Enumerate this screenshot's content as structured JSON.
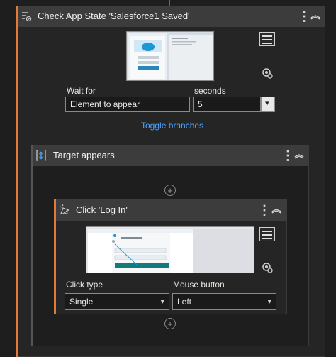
{
  "outer": {
    "title": "Check App State 'Salesforce1 Saved'",
    "wait_for_label": "Wait for",
    "wait_for_value": "Element to appear",
    "seconds_label": "seconds",
    "seconds_value": "5",
    "toggle_branches": "Toggle branches"
  },
  "target": {
    "title": "Target appears"
  },
  "click": {
    "title": "Click 'Log In'",
    "click_type_label": "Click type",
    "click_type_value": "Single",
    "mouse_button_label": "Mouse button",
    "mouse_button_value": "Left"
  },
  "glyphs": {
    "kebab": "⋮",
    "collapse": "︽",
    "plus": "+",
    "caret": "▾"
  },
  "colors": {
    "accent": "#e07b3a",
    "link": "#4aa3ff"
  }
}
